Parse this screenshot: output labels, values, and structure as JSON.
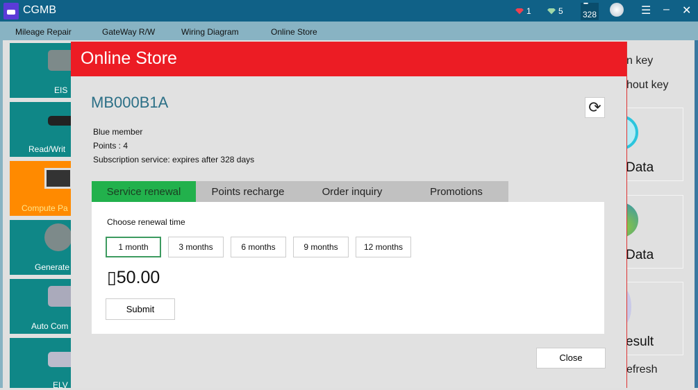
{
  "app": {
    "title": "CGMB",
    "red_gems": "1",
    "green_gems": "5",
    "days_counter": "328"
  },
  "menu": [
    "Mileage Repair",
    "GateWay R/W",
    "Wiring Diagram",
    "Online Store"
  ],
  "sidebar": [
    "EIS",
    "Read/Writ",
    "Compute Pa",
    "Generate",
    "Auto Com",
    "ELV"
  ],
  "right_panel": {
    "line1": "n key",
    "line2": "hout key",
    "box1": "Data",
    "box2": "Data",
    "box3": "esult",
    "refresh": "efresh"
  },
  "dialog": {
    "title": "Online Store",
    "account": "MB000B1A",
    "membership": "Blue member",
    "points": "Points : 4",
    "subscription": "Subscription service: expires after 328 days",
    "tabs": [
      "Service renewal",
      "Points recharge",
      "Order inquiry",
      "Promotions"
    ],
    "active_tab": "Service renewal",
    "choose_label": "Choose renewal time",
    "options": [
      "1 month",
      "3 months",
      "6 months",
      "9 months",
      "12 months"
    ],
    "selected_option": "1 month",
    "price": "▯50.00",
    "submit": "Submit",
    "close": "Close"
  },
  "colors": {
    "titlebar": "#106187",
    "dialog_header": "#ec1c24",
    "active_tab": "#22b14c",
    "sidebar_tile": "#0f8787",
    "sidebar_active": "#ff8a00"
  }
}
